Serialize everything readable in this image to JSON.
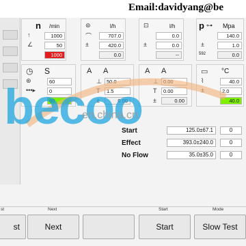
{
  "banner": {
    "email": "Email:davidyang@be"
  },
  "panels": {
    "speed": {
      "symbol": "n",
      "unit": "/min",
      "values": [
        "1000",
        "50",
        "1000"
      ]
    },
    "flow": {
      "unit": "l/h",
      "values": [
        "707.0",
        "420.0",
        "0.0"
      ]
    },
    "return": {
      "unit": "l/h",
      "values": [
        "0.0",
        "0.0",
        "--"
      ]
    },
    "pressure": {
      "symbol": "p",
      "unit": "Mpa",
      "values": [
        "140.0",
        "1.0",
        "0.0"
      ],
      "aux_label": "592"
    },
    "time": {
      "symbol": "S",
      "values": [
        "60",
        "0",
        "60"
      ]
    },
    "current1": {
      "symbol_a": "A",
      "symbol_b": "A",
      "values": [
        "50.0",
        "1.5",
        "0.00"
      ]
    },
    "current2": {
      "symbol_a": "A",
      "symbol_b": "A",
      "values": [
        "0.00",
        "0.00",
        "0.00"
      ]
    },
    "temp": {
      "unit": "°C",
      "values": [
        "40.0",
        "2.0",
        "40.0"
      ]
    }
  },
  "watermark": {
    "brand": "becoo",
    "site": "en.china.cn"
  },
  "results": [
    {
      "label": "Start",
      "range": "125.0±67.1",
      "value": "0"
    },
    {
      "label": "Effect",
      "range": "393.0±240.0",
      "value": "0"
    },
    {
      "label": "No Flow",
      "range": "35.0±35.0",
      "value": "0"
    }
  ],
  "captions": {
    "test": "st",
    "next": "Next",
    "start": "Start",
    "mode": "Mode"
  },
  "buttons": {
    "test": "st",
    "next": "Next",
    "start": "Start",
    "slow_test": "Slow Test"
  },
  "colors": {
    "alarm": "#e21d1d",
    "ok": "#7ef000",
    "watermark": "#1fa6df"
  }
}
